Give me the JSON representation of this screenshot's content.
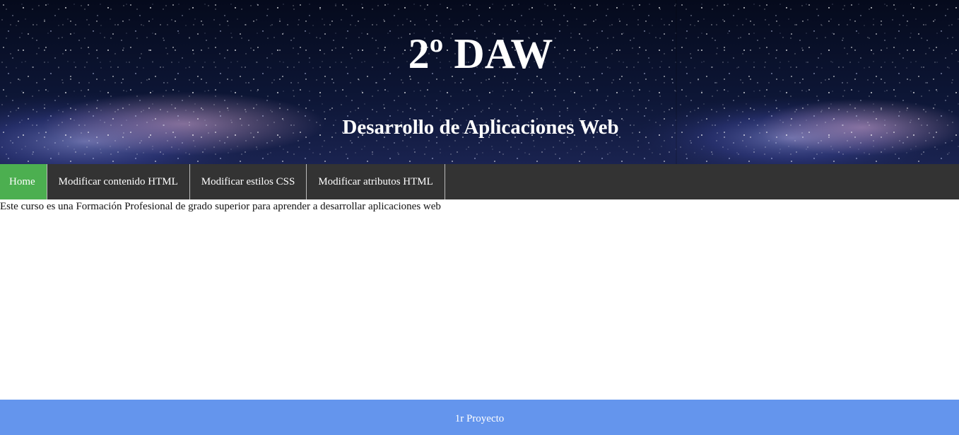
{
  "header": {
    "title": "2º DAW",
    "subtitle": "Desarrollo de Aplicaciones Web"
  },
  "nav": {
    "items": [
      {
        "label": "Home",
        "active": true
      },
      {
        "label": "Modificar contenido HTML",
        "active": false
      },
      {
        "label": "Modificar estilos CSS",
        "active": false
      },
      {
        "label": "Modificar atributos HTML",
        "active": false
      }
    ]
  },
  "main": {
    "text": "Este curso es una Formación Profesional de grado superior para aprender a desarrollar aplicaciones web"
  },
  "footer": {
    "text": "1r Proyecto"
  },
  "colors": {
    "nav_bg": "#333333",
    "nav_active": "#4caf50",
    "footer_bg": "#6495ed",
    "header_bg": "#0a1024"
  },
  "icons": {
    "header_background": "starry-sky-milky-way-image"
  }
}
